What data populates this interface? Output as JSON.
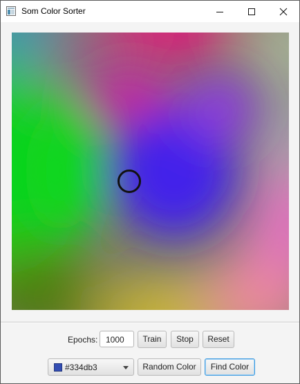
{
  "window": {
    "title": "Som Color Sorter"
  },
  "colors": {
    "selected_swatch": "#334db3",
    "focus_border": "#3c9ae0"
  },
  "icons": {
    "app": "app-window-icon",
    "minimize": "minimize-icon",
    "maximize": "maximize-icon",
    "close": "close-icon",
    "dropdown": "chevron-down-icon"
  },
  "controls": {
    "epochs_label": "Epochs:",
    "epochs_value": "1000",
    "train_label": "Train",
    "stop_label": "Stop",
    "reset_label": "Reset",
    "color_value": "#334db3",
    "random_color_label": "Random Color",
    "find_color_label": "Find Color"
  }
}
